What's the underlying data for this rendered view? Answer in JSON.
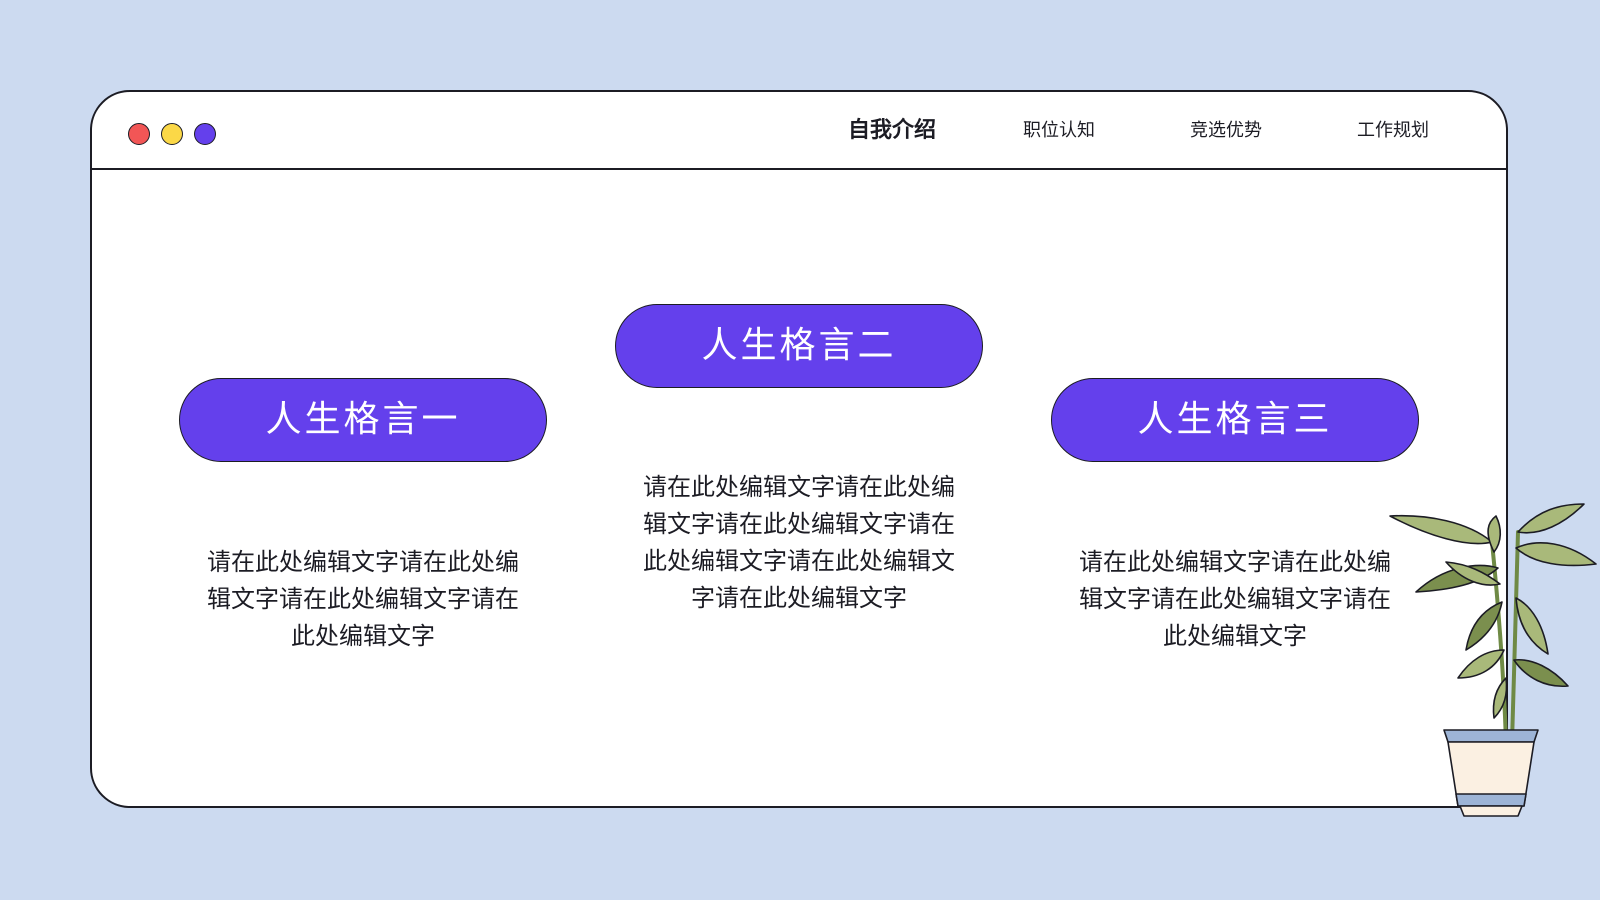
{
  "colors": {
    "background": "#ccdaf0",
    "accent": "#6440ec",
    "dot_red": "#f25656",
    "dot_yellow": "#fbd847",
    "dot_purple": "#6440ec",
    "leaf": "#a9b97a",
    "leaf_dark": "#7b8f4e",
    "pot": "#fbf0e2",
    "pot_band": "#9db4d6"
  },
  "nav": {
    "items": [
      {
        "label": "自我介绍",
        "active": true
      },
      {
        "label": "职位认知",
        "active": false
      },
      {
        "label": "竞选优势",
        "active": false
      },
      {
        "label": "工作规划",
        "active": false
      }
    ]
  },
  "cards": [
    {
      "title": "人生格言一",
      "text": "请在此处编辑文字请在此处编辑文字请在此处编辑文字请在此处编辑文字"
    },
    {
      "title": "人生格言二",
      "text": "请在此处编辑文字请在此处编辑文字请在此处编辑文字请在此处编辑文字请在此处编辑文字请在此处编辑文字"
    },
    {
      "title": "人生格言三",
      "text": "请在此处编辑文字请在此处编辑文字请在此处编辑文字请在此处编辑文字"
    }
  ],
  "icons": {
    "plant": "potted-plant-icon",
    "window_dots": [
      "close-dot",
      "minimize-dot",
      "maximize-dot"
    ]
  }
}
